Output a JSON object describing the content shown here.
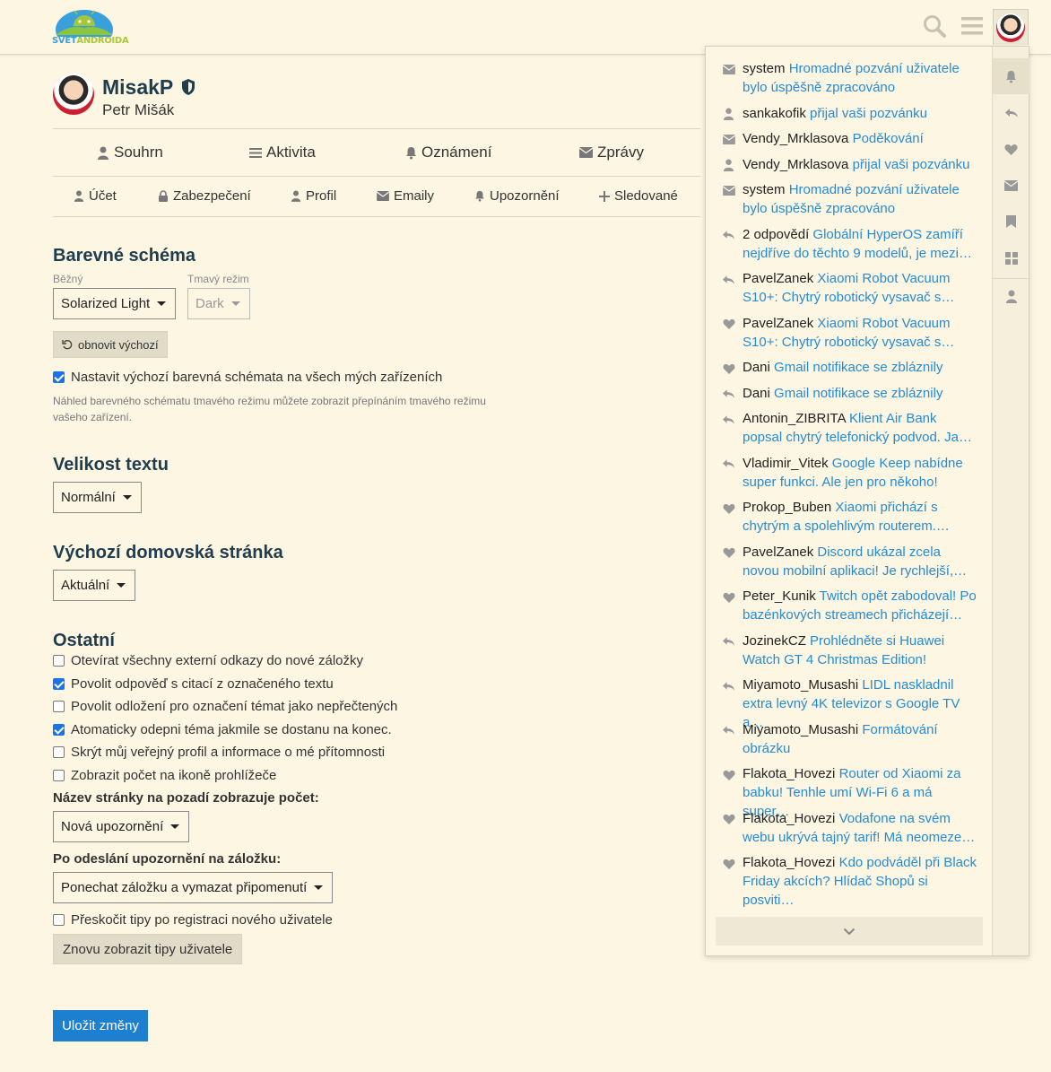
{
  "header": {
    "logo": {
      "part1": "SVĚT",
      "part2": "ANDROIDA"
    },
    "search_icon": "search-icon",
    "menu_icon": "hamburger-icon"
  },
  "profile": {
    "username": "MisakP",
    "realname": "Petr Mišák"
  },
  "tabs_primary": [
    {
      "label": "Souhrn",
      "icon": "user-icon"
    },
    {
      "label": "Aktivita",
      "icon": "list-icon"
    },
    {
      "label": "Oznámení",
      "icon": "bell-icon"
    },
    {
      "label": "Zprávy",
      "icon": "envelope-icon"
    }
  ],
  "tabs_secondary": [
    {
      "label": "Účet",
      "icon": "user-icon"
    },
    {
      "label": "Zabezpečení",
      "icon": "lock-icon"
    },
    {
      "label": "Profil",
      "icon": "user-icon"
    },
    {
      "label": "Emaily",
      "icon": "envelope-icon"
    },
    {
      "label": "Upozornění",
      "icon": "bell-icon"
    },
    {
      "label": "Sledované",
      "icon": "plus-icon"
    }
  ],
  "color_scheme": {
    "heading": "Barevné schéma",
    "regular_label": "Běžný",
    "regular_value": "Solarized Light",
    "dark_label": "Tmavý režim",
    "dark_value": "Dark",
    "reset_button": "obnovit výchozí",
    "default_checkbox": "Nastavit výchozí barevná schémata na všech mých zařízeních",
    "hint": "Náhled barevného schématu tmavého režimu můžete zobrazit přepínáním tmavého režimu vašeho zařízení."
  },
  "text_size": {
    "heading": "Velikost textu",
    "value": "Normální"
  },
  "homepage": {
    "heading": "Výchozí domovská stránka",
    "value": "Aktuální"
  },
  "other": {
    "heading": "Ostatní",
    "checkboxes": [
      {
        "label": "Otevírat všechny externí odkazy do nové záložky",
        "checked": false
      },
      {
        "label": "Povolit odpověď s citací z označeného textu",
        "checked": true
      },
      {
        "label": "Povolit odložení pro označení témat jako nepřečtených",
        "checked": false
      },
      {
        "label": "Atomaticky odepni téma jakmile se dostanu na konec.",
        "checked": true
      },
      {
        "label": "Skrýt můj veřejný profil a informace o mé přítomnosti",
        "checked": false
      },
      {
        "label": "Zobrazit počet na ikoně prohlížeče",
        "checked": false
      }
    ],
    "bg_title_label": "Název stránky na pozadí zobrazuje počet:",
    "bg_title_value": "Nová upozornění",
    "after_send_label": "Po odeslání upozornění na záložku:",
    "after_send_value": "Ponechat záložku a vymazat připomenutí",
    "skip_tips": {
      "label": "Přeskočit tipy po registraci nového uživatele",
      "checked": false
    },
    "show_tips_button": "Znovu zobrazit tipy uživatele"
  },
  "save_button": "Uložit změny",
  "notifications": [
    {
      "icon": "envelope-icon",
      "user": "system",
      "text": "Hromadné pozvání uživatele bylo úspěšně zpracováno",
      "lines": 2
    },
    {
      "icon": "user-icon",
      "user": "sankakofik",
      "text": "přijal vaši pozvánku",
      "lines": 1
    },
    {
      "icon": "envelope-icon",
      "user": "Vendy_Mrklasova",
      "text": "Poděkování",
      "lines": 1
    },
    {
      "icon": "user-icon",
      "user": "Vendy_Mrklasova",
      "text": "přijal vaši pozvánku",
      "lines": 1
    },
    {
      "icon": "envelope-icon",
      "user": "system",
      "text": "Hromadné pozvání uživatele bylo úspěšně zpracováno",
      "lines": 2
    },
    {
      "icon": "reply-icon",
      "user": "2 odpovědí",
      "text": "Globální HyperOS zamíří nejdříve do těchto 9 modelů, je mezi…",
      "lines": 2
    },
    {
      "icon": "reply-icon",
      "user": "PavelZanek",
      "text": "Xiaomi Robot Vacuum S10+: Chytrý robotický vysavač s…",
      "lines": 2
    },
    {
      "icon": "heart-icon",
      "user": "PavelZanek",
      "text": "Xiaomi Robot Vacuum S10+: Chytrý robotický vysavač s…",
      "lines": 2
    },
    {
      "icon": "heart-icon",
      "user": "Dani",
      "text": "Gmail notifikace se zbláznily",
      "lines": 1
    },
    {
      "icon": "reply-icon",
      "user": "Dani",
      "text": "Gmail notifikace se zbláznily",
      "lines": 1
    },
    {
      "icon": "reply-icon",
      "user": "Antonin_ZIBRITA",
      "text": "Klient Air Bank popsal chytrý telefonický podvod. Ja…",
      "lines": 2
    },
    {
      "icon": "reply-icon",
      "user": "Vladimir_Vitek",
      "text": "Google Keep nabídne super funkci. Ale jen pro někoho!",
      "lines": 2
    },
    {
      "icon": "heart-icon",
      "user": "Prokop_Buben",
      "text": "Xiaomi přichází s chytrým a spolehlivým routerem.…",
      "lines": 2
    },
    {
      "icon": "heart-icon",
      "user": "PavelZanek",
      "text": "Discord ukázal zcela novou mobilní aplikaci! Je rychlejší,…",
      "lines": 2
    },
    {
      "icon": "heart-icon",
      "user": "Peter_Kunik",
      "text": "Twitch opět zabodoval! Po bazénkových streamech přicházejí…",
      "lines": 2
    },
    {
      "icon": "reply-icon",
      "user": "JozinekCZ",
      "text": "Prohlédněte si Huawei Watch GT 4 Christmas Edition!",
      "lines": 2
    },
    {
      "icon": "reply-icon",
      "user": "Miyamoto_Musashi",
      "text": "LIDL naskladnil extra levný 4K televizor s Google TV a…",
      "lines": 2
    },
    {
      "icon": "reply-icon",
      "user": "Miyamoto_Musashi",
      "text": "Formátování obrázku",
      "lines": 2
    },
    {
      "icon": "heart-icon",
      "user": "Flakota_Hovezi",
      "text": "Router od Xiaomi za babku! Tenhle umí Wi-Fi 6 a má super…",
      "lines": 2
    },
    {
      "icon": "heart-icon",
      "user": "Flakota_Hovezi",
      "text": "Vodafone na svém webu ukrývá tajný tarif! Má neomeze…",
      "lines": 2
    },
    {
      "icon": "heart-icon",
      "user": "Flakota_Hovezi",
      "text": "Kdo podváděl při Black Friday akcích? Hlídač Shopů si posviti…",
      "lines": 2
    }
  ],
  "panel_sidebar": [
    "bell-icon",
    "reply-icon",
    "heart-icon",
    "envelope-icon",
    "bookmark-icon",
    "grid-icon",
    "user-icon"
  ],
  "colors": {
    "background": "#fdf6e3",
    "link": "#268bd2",
    "primary_button": "#1d7fd0",
    "heading": "#1f3d4d"
  }
}
